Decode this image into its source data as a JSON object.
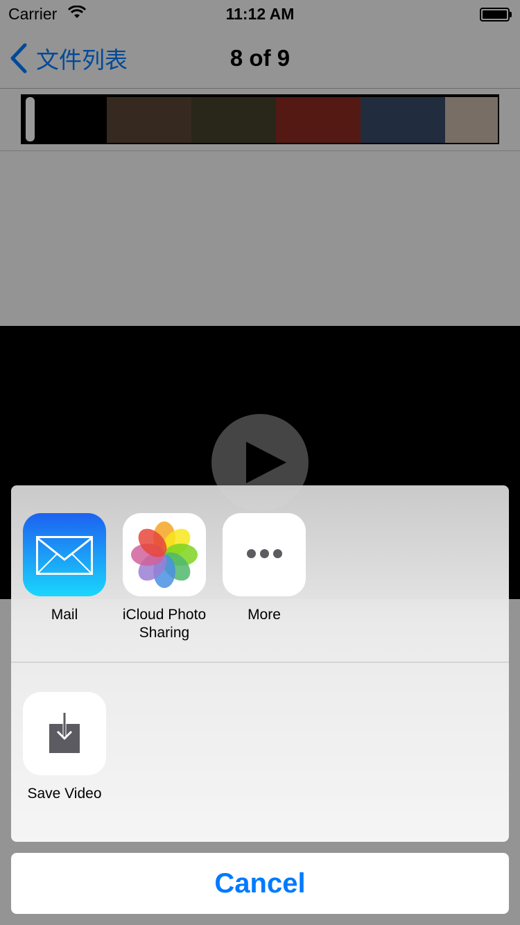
{
  "status_bar": {
    "carrier": "Carrier",
    "time": "11:12 AM",
    "wifi_icon": "wifi-icon",
    "battery_icon": "battery-icon"
  },
  "nav": {
    "back_label": "文件列表",
    "title": "8 of 9",
    "back_icon": "chevron-left-icon"
  },
  "filmstrip": {
    "frames": [
      {
        "color": "#000000"
      },
      {
        "color": "#5b4534"
      },
      {
        "color": "#44422c"
      },
      {
        "color": "#8c2a20"
      },
      {
        "color": "#3a4a6a"
      },
      {
        "color": "#c9b8a8"
      }
    ]
  },
  "share_sheet": {
    "apps": [
      {
        "label": "Mail",
        "icon": "mail-icon"
      },
      {
        "label": "iCloud Photo Sharing",
        "icon": "photos-icon"
      },
      {
        "label": "More",
        "icon": "more-icon"
      }
    ],
    "actions": [
      {
        "label": "Save Video",
        "icon": "save-video-icon"
      }
    ]
  },
  "cancel_label": "Cancel",
  "colors": {
    "accent": "#007aff",
    "dim_overlay": "rgba(0,0,0,0.4)"
  }
}
